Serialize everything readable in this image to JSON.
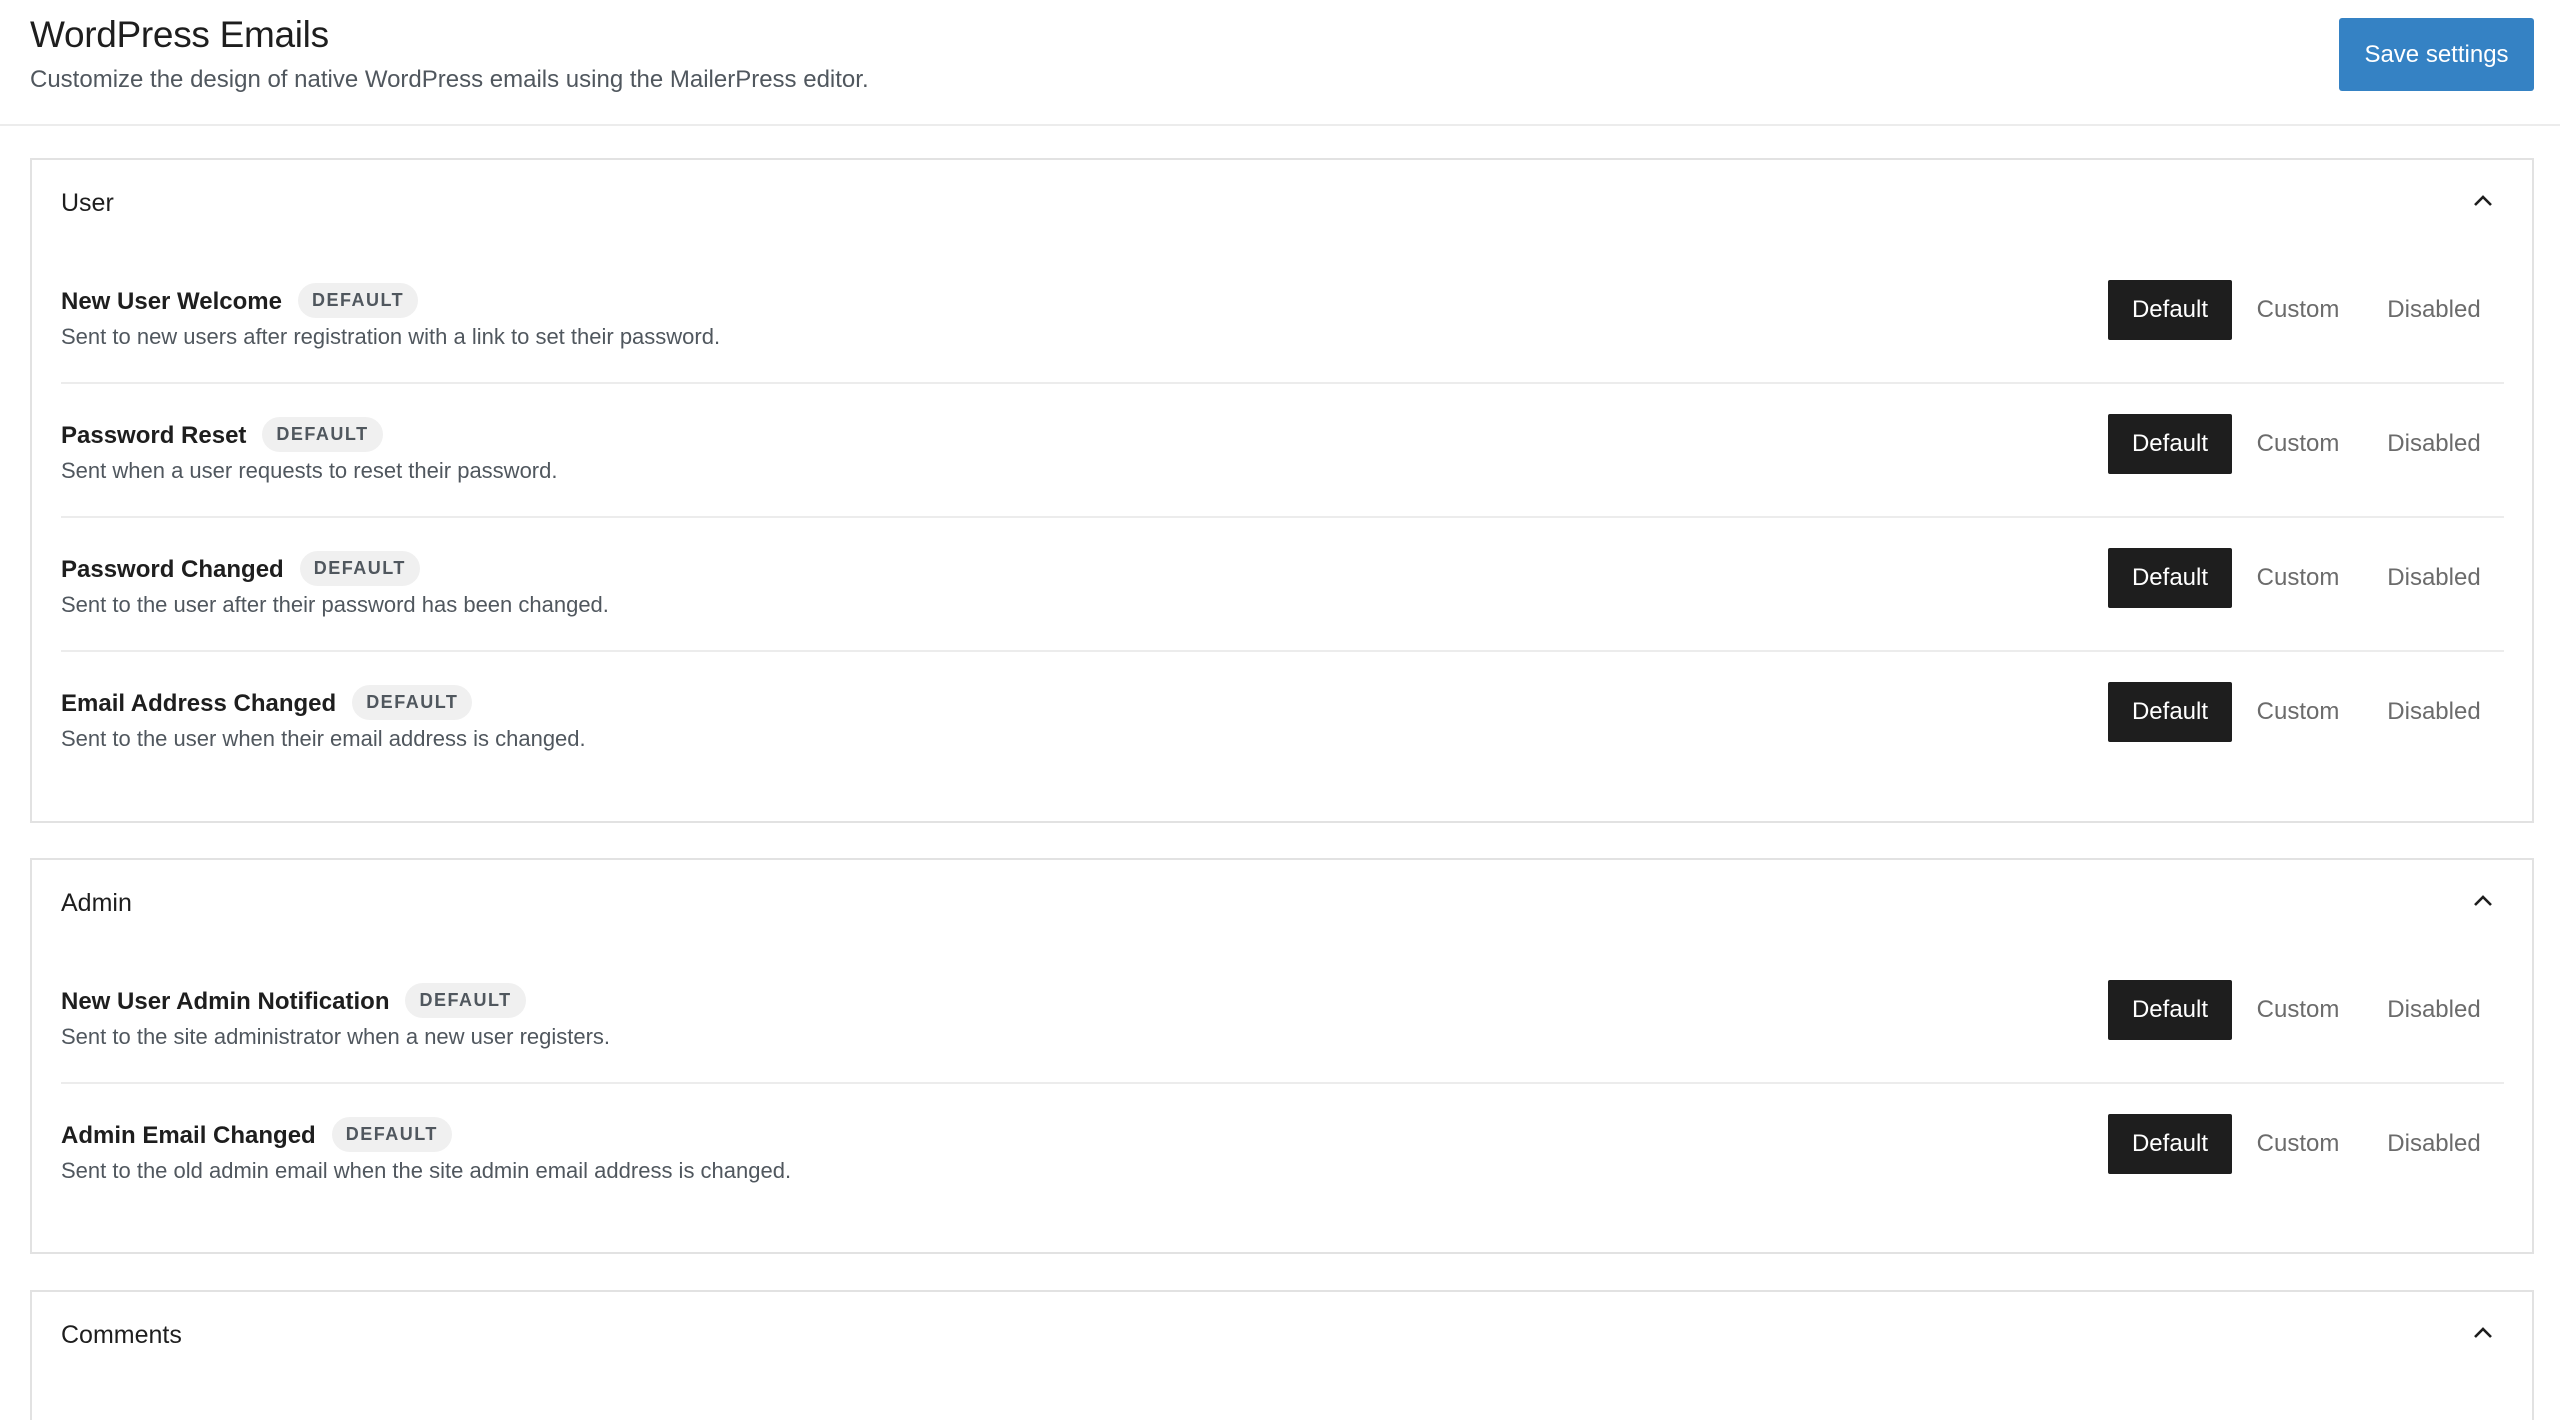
{
  "header": {
    "title": "WordPress Emails",
    "subtitle": "Customize the design of native WordPress emails using the MailerPress editor.",
    "save_label": "Save settings"
  },
  "colors": {
    "primary_button": "#3582c4",
    "active_segment": "#1e1e1e"
  },
  "options": {
    "default": "Default",
    "custom": "Custom",
    "disabled": "Disabled"
  },
  "badge_label": "DEFAULT",
  "sections": [
    {
      "title": "User",
      "chevron_icon": "chevron-up-icon",
      "items": [
        {
          "title": "New User Welcome",
          "description": "Sent to new users after registration with a link to set their password.",
          "selected": "Default"
        },
        {
          "title": "Password Reset",
          "description": "Sent when a user requests to reset their password.",
          "selected": "Default"
        },
        {
          "title": "Password Changed",
          "description": "Sent to the user after their password has been changed.",
          "selected": "Default"
        },
        {
          "title": "Email Address Changed",
          "description": "Sent to the user when their email address is changed.",
          "selected": "Default"
        }
      ]
    },
    {
      "title": "Admin",
      "chevron_icon": "chevron-up-icon",
      "items": [
        {
          "title": "New User Admin Notification",
          "description": "Sent to the site administrator when a new user registers.",
          "selected": "Default"
        },
        {
          "title": "Admin Email Changed",
          "description": "Sent to the old admin email when the site admin email address is changed.",
          "selected": "Default"
        }
      ]
    },
    {
      "title": "Comments",
      "chevron_icon": "chevron-up-icon",
      "items": []
    }
  ]
}
